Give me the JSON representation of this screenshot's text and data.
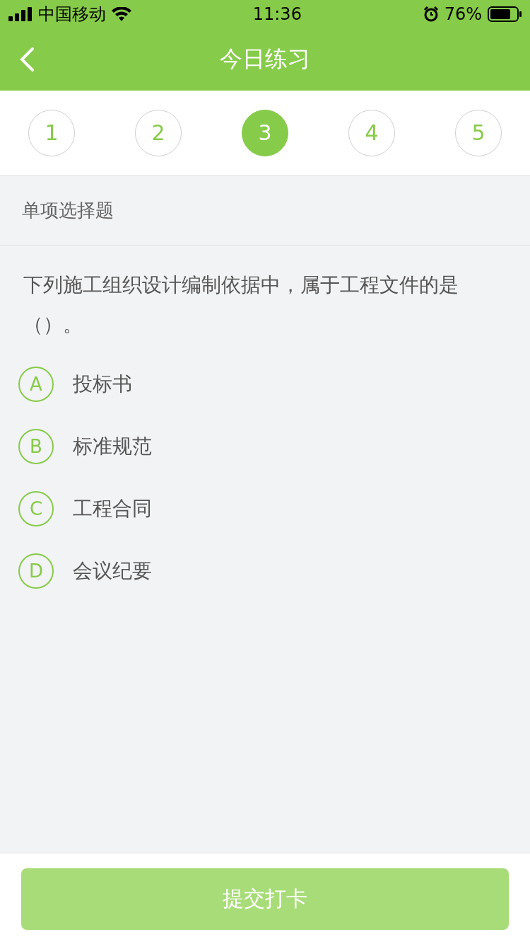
{
  "status_bar": {
    "carrier": "中国移动",
    "time": "11:36",
    "battery": "76%"
  },
  "nav": {
    "title": "今日练习"
  },
  "steps": [
    {
      "label": "1",
      "selected": false
    },
    {
      "label": "2",
      "selected": false
    },
    {
      "label": "3",
      "selected": true
    },
    {
      "label": "4",
      "selected": false
    },
    {
      "label": "5",
      "selected": false
    }
  ],
  "section_title": "单项选择题",
  "question": "下列施工组织设计编制依据中，属于工程文件的是（）。",
  "options": [
    {
      "letter": "A",
      "text": "投标书",
      "selected": false
    },
    {
      "letter": "B",
      "text": "标准规范",
      "selected": false
    },
    {
      "letter": "C",
      "text": "工程合同",
      "selected": false
    },
    {
      "letter": "D",
      "text": "会议纪要",
      "selected": false
    }
  ],
  "submit": {
    "label": "提交打卡",
    "disabled": true
  }
}
